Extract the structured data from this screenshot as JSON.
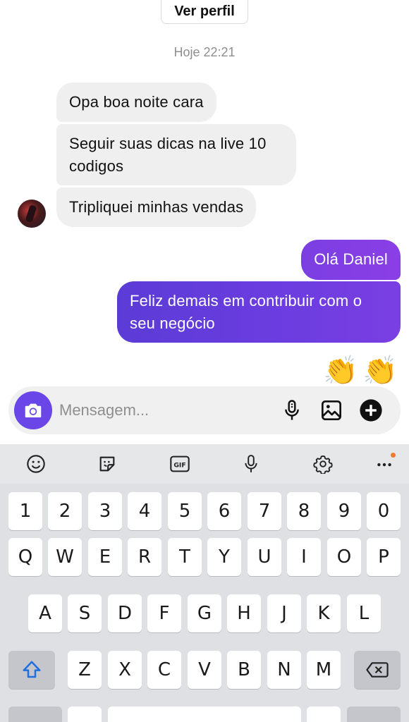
{
  "header": {
    "profile_button": "Ver perfil",
    "timestamp": "Hoje 22:21"
  },
  "messages": {
    "received": [
      "Opa boa noite cara",
      "Seguir suas dicas na live 10 codigos",
      "Tripliquei minhas vendas"
    ],
    "sent": [
      "Olá Daniel",
      "Feliz demais em contribuir com o seu negócio"
    ],
    "reactions": "👏👏"
  },
  "composer": {
    "placeholder": "Mensagem..."
  },
  "icons": {
    "camera": "camera-icon",
    "mic": "microphone-icon",
    "gallery": "image-icon",
    "plus": "plus-circle-icon",
    "toolbar": [
      "emoji-icon",
      "sticker-icon",
      "gif-icon",
      "microphone-icon",
      "settings-icon",
      "more-icon"
    ],
    "shift": "shift-icon",
    "backspace": "backspace-icon"
  },
  "colors": {
    "accent": "#6a46e8",
    "sent_bubble": "#5b3bd6",
    "received_bubble": "#efefef",
    "badge": "#f07a2e"
  },
  "keyboard": {
    "toolbar_gif": "GIF",
    "row_numbers": [
      "1",
      "2",
      "3",
      "4",
      "5",
      "6",
      "7",
      "8",
      "9",
      "0"
    ],
    "row_1": [
      "Q",
      "W",
      "E",
      "R",
      "T",
      "Y",
      "U",
      "I",
      "O",
      "P"
    ],
    "row_2": [
      "A",
      "S",
      "D",
      "F",
      "G",
      "H",
      "J",
      "K",
      "L"
    ],
    "row_3": [
      "Z",
      "X",
      "C",
      "V",
      "B",
      "N",
      "M"
    ]
  }
}
